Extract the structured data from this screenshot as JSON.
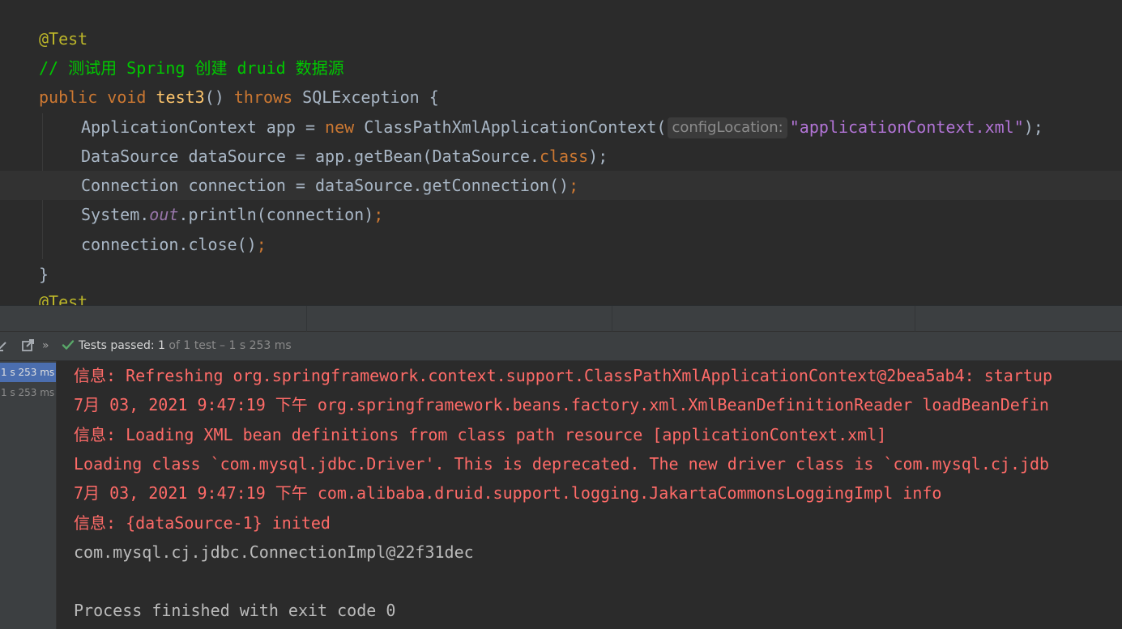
{
  "editor": {
    "lines": [
      {
        "annotation": "@Test"
      },
      {
        "comment": "// 测试用 Spring 创建 druid 数据源"
      },
      {
        "kw_public": "public",
        "kw_void": "void",
        "method": "test3",
        "parens": "()",
        "kw_throws": "throws",
        "exception": "SQLException {"
      },
      {
        "text_a": "ApplicationContext app = ",
        "kw_new": "new",
        "text_b": " ClassPathXmlApplicationContext(",
        "param_hint": "configLocation:",
        "string": "\"applicationContext.xml\"",
        "text_c": ");"
      },
      {
        "text_a": "DataSource dataSource = app.getBean(DataSource.",
        "kw_class": "class",
        "text_b": ");"
      },
      {
        "text_a": "Connection connection = dataSource.getConnection()",
        "semi": ";"
      },
      {
        "text_a": "System.",
        "field": "out",
        "text_b": ".println(connection)",
        "semi": ";"
      },
      {
        "text_a": "connection.close()",
        "semi": ";"
      },
      {
        "brace": "}"
      },
      {
        "annotation": "@Test"
      }
    ]
  },
  "run_toolbar": {
    "more_label": "»",
    "status_prefix": "Tests passed:",
    "status_count": "1",
    "status_suffix": "of 1 test – 1 s 253 ms"
  },
  "test_tree": {
    "rows": [
      {
        "duration": "1 s 253 ms"
      },
      {
        "duration": "1 s 253 ms"
      }
    ]
  },
  "console": {
    "lines": [
      "信息: Refreshing org.springframework.context.support.ClassPathXmlApplicationContext@2bea5ab4: startup",
      "7月 03, 2021 9:47:19 下午 org.springframework.beans.factory.xml.XmlBeanDefinitionReader loadBeanDefin",
      "信息: Loading XML bean definitions from class path resource [applicationContext.xml]",
      "Loading class `com.mysql.jdbc.Driver'. This is deprecated. The new driver class is `com.mysql.cj.jdb",
      "7月 03, 2021 9:47:19 下午 com.alibaba.druid.support.logging.JakartaCommonsLoggingImpl info",
      "信息: {dataSource-1} inited",
      "com.mysql.cj.jdbc.ConnectionImpl@22f31dec",
      "",
      "Process finished with exit code 0"
    ]
  },
  "colors": {
    "keyword": "#cc7832",
    "annotation": "#bbb529",
    "comment": "#00c900",
    "string": "#b274d6",
    "method": "#ffc66d",
    "console_error": "#ff6b68",
    "pass_check": "#59a869",
    "tree_selection": "#4b6eaf"
  },
  "icons": {
    "toolbar": [
      "import-tests-icon",
      "export-tests-icon"
    ],
    "status": "check-icon"
  }
}
